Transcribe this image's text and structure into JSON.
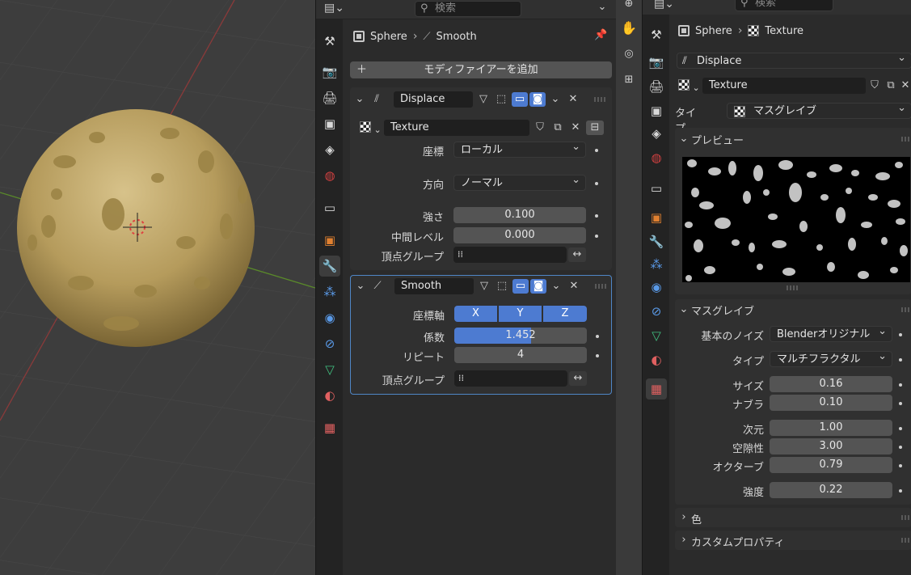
{
  "left_editor": {
    "search_placeholder": "検索",
    "breadcrumb": {
      "object": "Sphere",
      "modifier": "Smooth"
    },
    "add_modifier_label": "モディファイアーを追加",
    "displace": {
      "name": "Displace",
      "texture_name": "Texture",
      "coords_label": "座標",
      "coords_value": "ローカル",
      "direction_label": "方向",
      "direction_value": "ノーマル",
      "strength_label": "強さ",
      "strength_value": "0.100",
      "midlevel_label": "中間レベル",
      "midlevel_value": "0.000",
      "vgroup_label": "頂点グループ"
    },
    "smooth": {
      "name": "Smooth",
      "axis_label": "座標軸",
      "axis_x": "X",
      "axis_y": "Y",
      "axis_z": "Z",
      "factor_label": "係数",
      "factor_value": "1.452",
      "repeat_label": "リピート",
      "repeat_value": "4",
      "vgroup_label": "頂点グループ"
    }
  },
  "right_editor": {
    "search_placeholder": "検索",
    "breadcrumb": {
      "object": "Sphere",
      "texture": "Texture"
    },
    "modifier_name": "Displace",
    "texture_name": "Texture",
    "type_label": "タイプ",
    "type_value": "マスグレイブ",
    "preview_title": "プレビュー",
    "musgrave_title": "マスグレイブ",
    "noise_basis_label": "基本のノイズ",
    "noise_basis_value": "Blenderオリジナル",
    "mtype_label": "タイプ",
    "mtype_value": "マルチフラクタル",
    "size_label": "サイズ",
    "size_value": "0.16",
    "nabla_label": "ナブラ",
    "nabla_value": "0.10",
    "dimension_label": "次元",
    "dimension_value": "1.00",
    "lacunarity_label": "空隙性",
    "lacunarity_value": "3.00",
    "octaves_label": "オクターブ",
    "octaves_value": "0.79",
    "intensity_label": "強度",
    "intensity_value": "0.22",
    "colors_title": "色",
    "custom_props_title": "カスタムプロパティ"
  },
  "colors": {
    "accent": "#4d7bd1",
    "panel": "#303030",
    "field": "#545454",
    "sphere": "#b8a064"
  }
}
